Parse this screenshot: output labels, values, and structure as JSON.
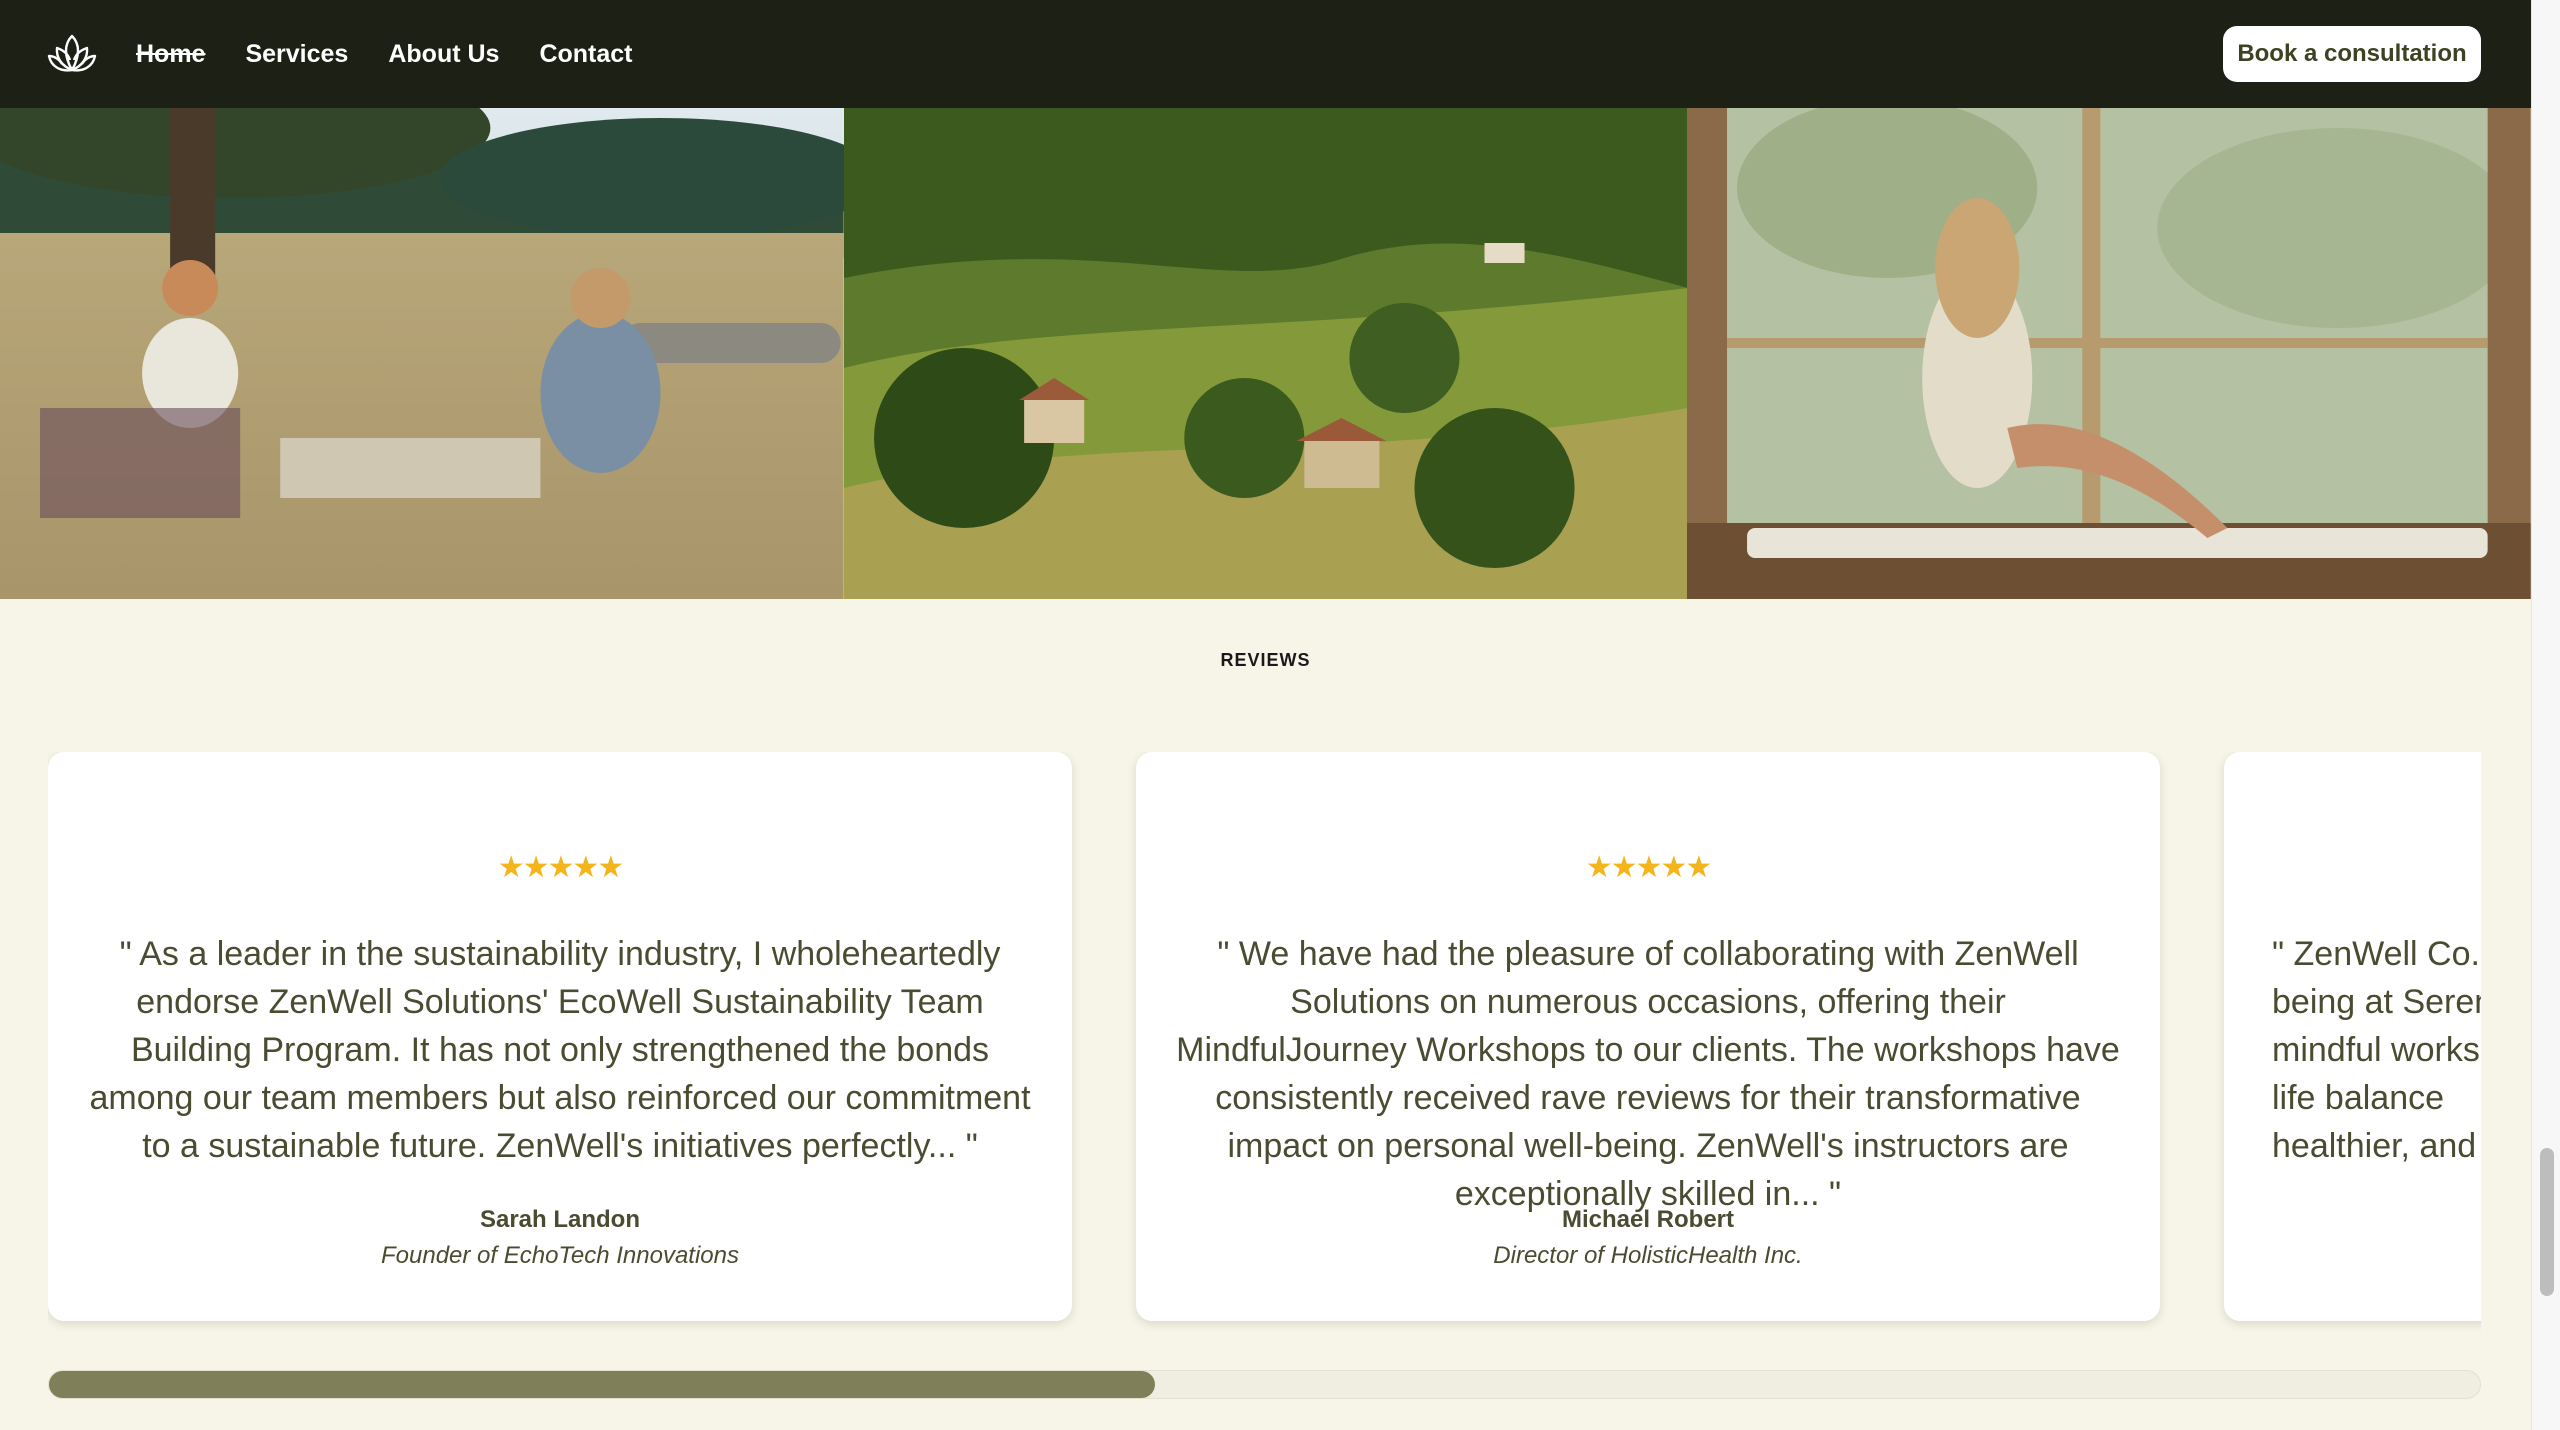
{
  "header": {
    "logo_icon": "lotus-icon",
    "nav": [
      {
        "label": "Home",
        "active": true
      },
      {
        "label": "Services"
      },
      {
        "label": "About Us"
      },
      {
        "label": "Contact"
      }
    ],
    "cta_label": "Book a consultation"
  },
  "gallery": {
    "photos": [
      "picnic-meadow-photo",
      "green-hills-village-photo",
      "woman-window-seat-photo"
    ]
  },
  "reviews": {
    "section_label": "REVIEWS",
    "items": [
      {
        "stars": "★★★★★",
        "quote": "\" As a leader in the sustainability industry, I wholeheartedly endorse ZenWell Solutions' EcoWell Sustainability Team Building Program. It has not only strengthened the bonds among our team members but also reinforced our commitment to a sustainable future. ZenWell's initiatives perfectly... \"",
        "name": "Sarah Landon",
        "role": "Founder of EchoTech Innovations"
      },
      {
        "stars": "★★★★★",
        "quote": "\" We have had the pleasure of collaborating with ZenWell Solutions on numerous occasions, offering their MindfulJourney Workshops to our clients. The workshops have consistently received rave reviews for their transformative impact on personal well-being. ZenWell's instructors are exceptionally skilled in... \"",
        "name": "Michael Robert",
        "role": "Director of HolisticHealth Inc."
      },
      {
        "stars": "",
        "quote": "\" ZenWell Co. l being at Seren mindful works life balance healthier, and",
        "name": "",
        "role": ""
      }
    ],
    "progress_fraction": 0.455
  },
  "colors": {
    "header_bg": "#1d2015",
    "page_bg": "#f7f5e7",
    "accent_text": "#4a4b30",
    "star": "#f3b51b",
    "progress_fill": "#7f7f59"
  }
}
